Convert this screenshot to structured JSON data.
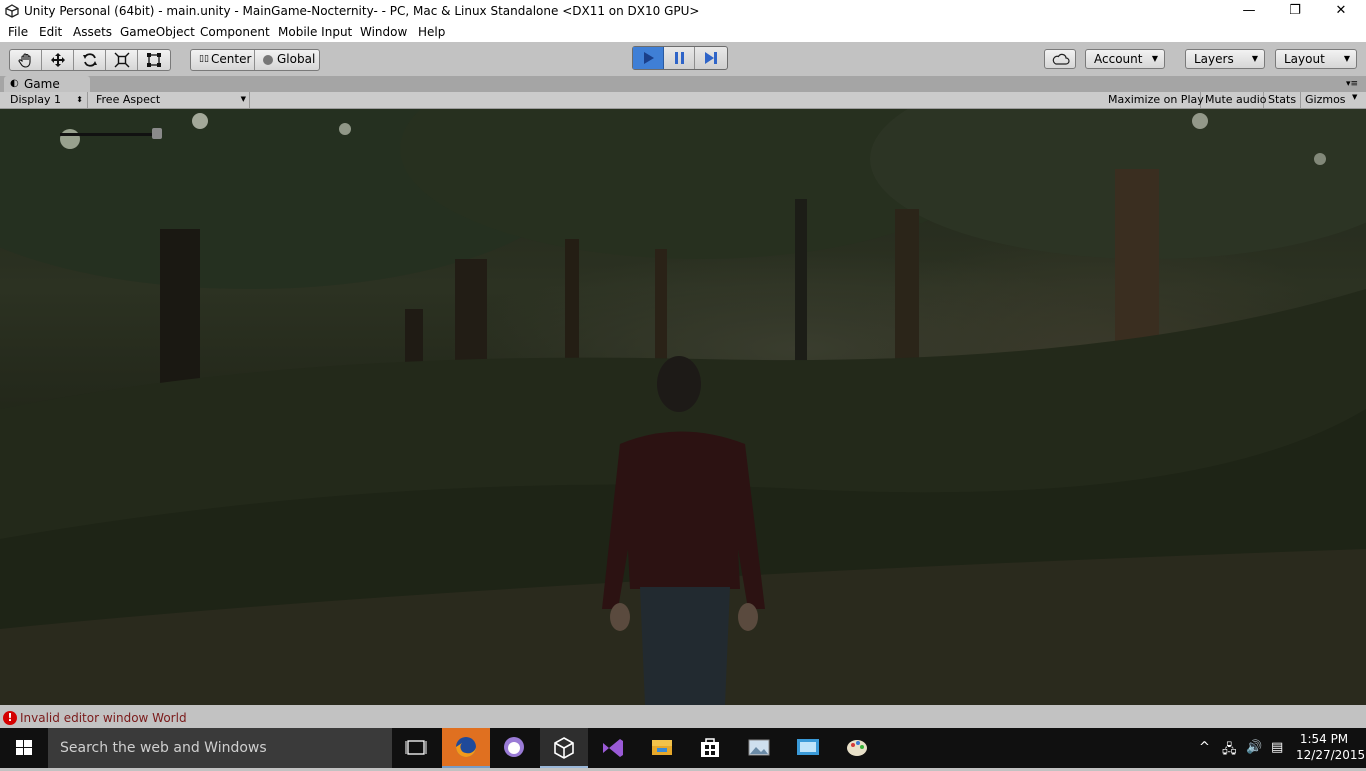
{
  "window": {
    "title": "Unity Personal (64bit) - main.unity - MainGame-Nocternity- - PC, Mac & Linux Standalone <DX11 on DX10 GPU>",
    "controls": {
      "minimize": "—",
      "maximize": "❐",
      "close": "✕"
    }
  },
  "menu": [
    "File",
    "Edit",
    "Assets",
    "GameObject",
    "Component",
    "Mobile Input",
    "Window",
    "Help"
  ],
  "toolbar": {
    "transform_tools": [
      "hand-tool",
      "move-tool",
      "rotate-tool",
      "scale-tool",
      "rect-tool"
    ],
    "pivot": "Center",
    "space": "Global",
    "playback": [
      "play",
      "pause",
      "step"
    ],
    "account": "Account",
    "layers": "Layers",
    "layout": "Layout"
  },
  "game_tab": {
    "label": "Game",
    "display": "Display 1",
    "aspect": "Free Aspect",
    "options": [
      "Maximize on Play",
      "Mute audio",
      "Stats",
      "Gizmos"
    ]
  },
  "status": {
    "message": "Invalid editor window World",
    "level": "error"
  },
  "taskbar": {
    "search_placeholder": "Search the web and Windows",
    "apps": [
      "task-view",
      "firefox",
      "github-desktop",
      "unity",
      "visual-studio",
      "file-explorer",
      "store",
      "image-viewer",
      "remote-desktop",
      "paint"
    ],
    "time": "1:54 PM",
    "date": "12/27/2015"
  },
  "colors": {
    "editor_bg": "#c2c2c2",
    "play_active": "#3f7fd6",
    "taskbar": "#101010",
    "error": "#d40000"
  }
}
